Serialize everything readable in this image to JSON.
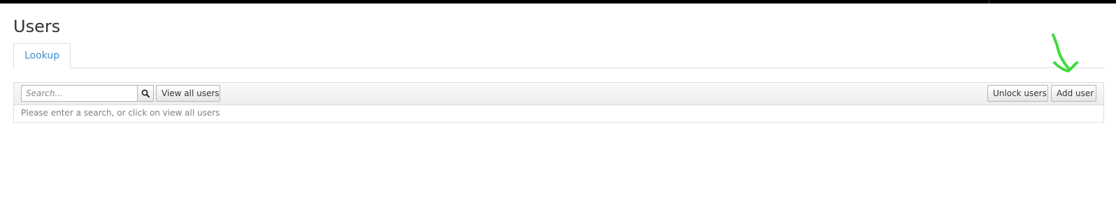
{
  "page": {
    "title": "Users"
  },
  "tabs": [
    {
      "label": "Lookup",
      "active": true
    }
  ],
  "toolbar": {
    "search_placeholder": "Search...",
    "search_icon": "search-icon",
    "view_all_label": "View all users",
    "unlock_label": "Unlock users",
    "add_label": "Add user"
  },
  "results": {
    "hint": "Please enter a search, or click on view all users"
  },
  "colors": {
    "tab_text": "#428bca",
    "annotation": "#3ddc3d"
  }
}
